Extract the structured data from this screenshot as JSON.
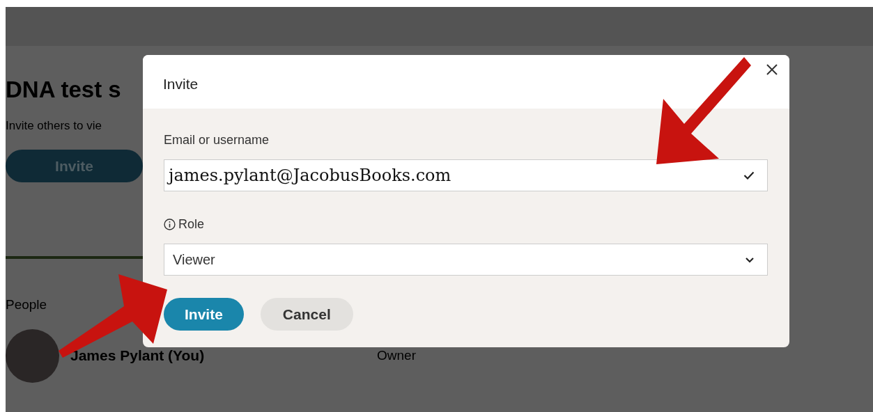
{
  "background_page": {
    "title": "DNA test s",
    "subtitle": "Invite others to vie",
    "invite_button": "Invite",
    "section": "People",
    "people": [
      {
        "name": "James Pylant (You)",
        "role": "Owner"
      }
    ]
  },
  "dialog": {
    "title": "Invite",
    "email": {
      "label": "Email or username",
      "value": "james.pylant@JacobusBooks.com",
      "valid": true
    },
    "role": {
      "label": "Role",
      "value": "Viewer"
    },
    "buttons": [
      {
        "label": "Invite",
        "kind": "primary"
      },
      {
        "label": "Cancel",
        "kind": "secondary"
      }
    ]
  }
}
